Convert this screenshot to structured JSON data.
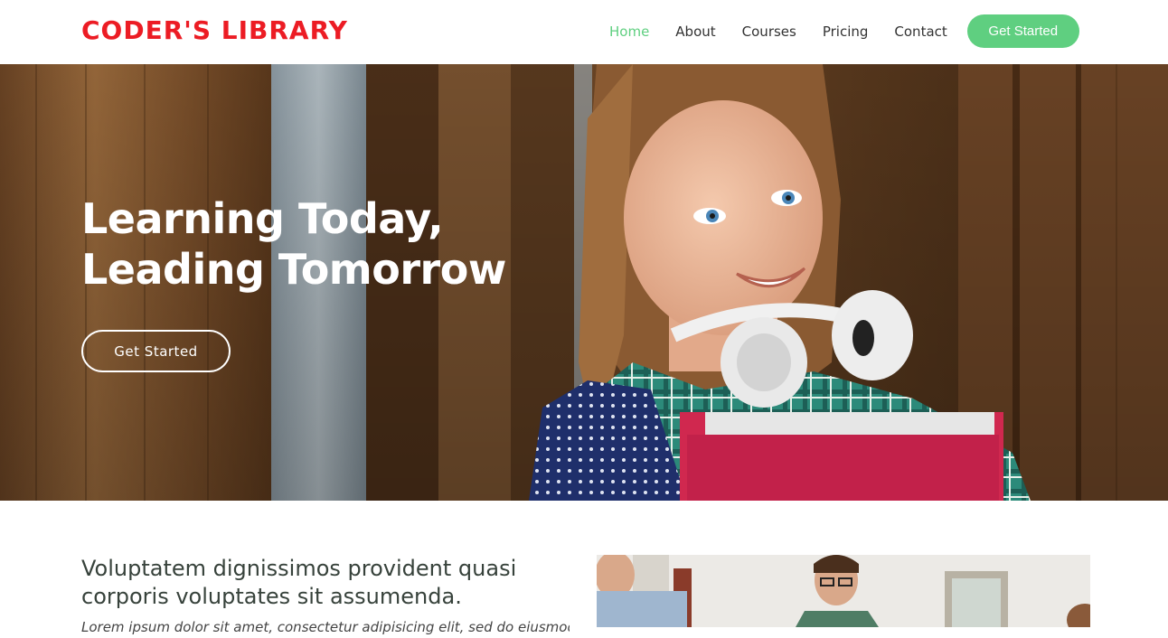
{
  "header": {
    "logo": "CODER'S LIBRARY",
    "nav": [
      {
        "label": "Home",
        "active": true
      },
      {
        "label": "About",
        "active": false
      },
      {
        "label": "Courses",
        "active": false
      },
      {
        "label": "Pricing",
        "active": false
      },
      {
        "label": "Contact",
        "active": false
      }
    ],
    "cta_label": "Get Started"
  },
  "hero": {
    "title_line1": "Learning Today,",
    "title_line2": "Leading Tomorrow",
    "button_label": "Get Started"
  },
  "about": {
    "heading": "Voluptatem dignissimos provident quasi corporis voluptates sit assumenda.",
    "text": "Lorem ipsum dolor sit amet, consectetur adipisicing elit, sed do eiusmod"
  },
  "colors": {
    "brand": "#ec1c24",
    "accent": "#5fcf80",
    "heading": "#37423b"
  }
}
